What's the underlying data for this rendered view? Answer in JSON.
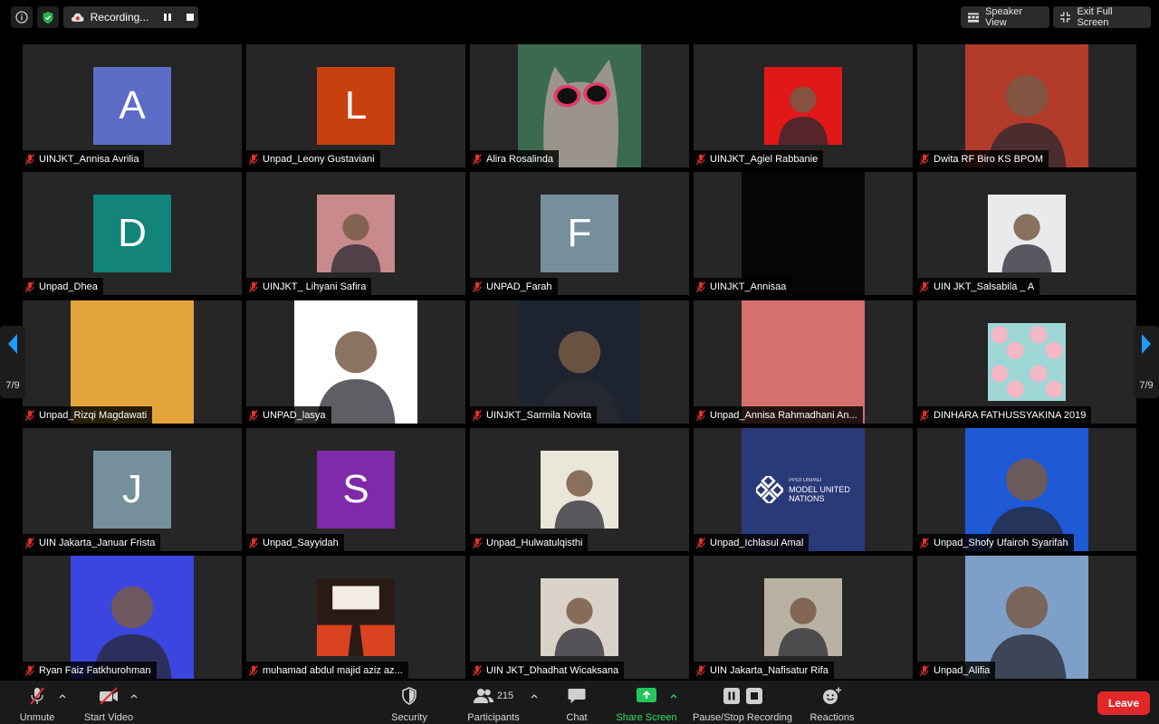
{
  "topbar": {
    "recording_label": "Recording...",
    "speaker_view_label": "Speaker View",
    "exit_full_screen_label": "Exit Full Screen"
  },
  "pager": {
    "left": "7/9",
    "right": "7/9"
  },
  "colors": {
    "tile_bg": "#262626",
    "leave": "#e02828",
    "share_green": "#22c55e"
  },
  "participants": [
    {
      "name": "UINJKT_Annisa Avrilia",
      "kind": "letter",
      "letter": "A",
      "bg": "#5d6cc7"
    },
    {
      "name": "Unpad_Leony Gustaviani",
      "kind": "letter",
      "letter": "L",
      "bg": "#c9400f"
    },
    {
      "name": "Alira Rosalinda",
      "kind": "photo",
      "bg": "#3a6b4e",
      "icon": "cat-with-sunglasses"
    },
    {
      "name": "UINJKT_Agiel Rabbanie",
      "kind": "thumb",
      "bg": "#e01818",
      "icon": "person-photo"
    },
    {
      "name": "Dwita RF Biro KS BPOM",
      "kind": "photo",
      "bg": "#b23b2a",
      "icon": "person-photo"
    },
    {
      "name": "Unpad_Dhea",
      "kind": "letter",
      "letter": "D",
      "bg": "#12847a"
    },
    {
      "name": "UINJKT_ Lihyani Safira",
      "kind": "thumb",
      "bg": "#c88a8a",
      "icon": "person-photo"
    },
    {
      "name": "UNPAD_Farah",
      "kind": "letter",
      "letter": "F",
      "bg": "#76909b"
    },
    {
      "name": "UINJKT_Annisaa",
      "kind": "photo",
      "bg": "#050505",
      "icon": "dark-video"
    },
    {
      "name": "UIN JKT_Salsabila _ A",
      "kind": "thumb",
      "bg": "#e8eaec",
      "icon": "person-photo"
    },
    {
      "name": "Unpad_Rizqi Magdawati",
      "kind": "photo",
      "bg": "#e3a53b",
      "icon": "solid-color"
    },
    {
      "name": "UNPAD_lasya",
      "kind": "photo",
      "bg": "#ffffff",
      "icon": "person-photo"
    },
    {
      "name": "UINJKT_Sarmila Novita",
      "kind": "photo",
      "bg": "#1d2430",
      "icon": "person-photo"
    },
    {
      "name": "Unpad_Annisa Rahmadhani An...",
      "kind": "photo",
      "bg": "#d4716e",
      "icon": "solid-color"
    },
    {
      "name": "DINHARA FATHUSSYAKINA 2019",
      "kind": "thumb",
      "bg": "#9fd6d6",
      "icon": "pattern"
    },
    {
      "name": "UIN Jakarta_Januar Frista",
      "kind": "letter",
      "letter": "J",
      "bg": "#76909b"
    },
    {
      "name": "Unpad_Sayyidah",
      "kind": "letter",
      "letter": "S",
      "bg": "#7f2aa8"
    },
    {
      "name": "Unpad_Hulwatulqisthi",
      "kind": "thumb",
      "bg": "#e9e6da",
      "icon": "graduation-photo"
    },
    {
      "name": "Unpad_Ichlasul Amal",
      "kind": "photo",
      "bg": "#2a3a78",
      "icon": "mun-logo",
      "logo_lines": [
        "PPDI UNPAD",
        "MODEL UNITED",
        "NATIONS"
      ]
    },
    {
      "name": "Unpad_Shofy Ufairoh Syarifah",
      "kind": "photo",
      "bg": "#1e5ad6",
      "icon": "person-photo"
    },
    {
      "name": "Ryan Faiz Fatkhurohman",
      "kind": "photo",
      "bg": "#3b45e0",
      "icon": "person-photo"
    },
    {
      "name": "muhamad abdul majid aziz az...",
      "kind": "thumb",
      "bg": "#2a1a14",
      "icon": "theater-seats"
    },
    {
      "name": "UIN JKT_Dhadhat Wicaksana",
      "kind": "thumb",
      "bg": "#d9d2c8",
      "icon": "person-photo"
    },
    {
      "name": "UIN Jakarta_Nafisatur Rifa",
      "kind": "thumb",
      "bg": "#b9b2a2",
      "icon": "person-photo"
    },
    {
      "name": "Unpad_Alifia",
      "kind": "photo",
      "bg": "#7ea0c8",
      "icon": "outdoor-photo"
    }
  ],
  "toolbar": {
    "unmute": "Unmute",
    "start_video": "Start Video",
    "security": "Security",
    "participants": "Participants",
    "participant_count": "215",
    "chat": "Chat",
    "share_screen": "Share Screen",
    "recording": "Pause/Stop Recording",
    "reactions": "Reactions",
    "leave": "Leave"
  }
}
